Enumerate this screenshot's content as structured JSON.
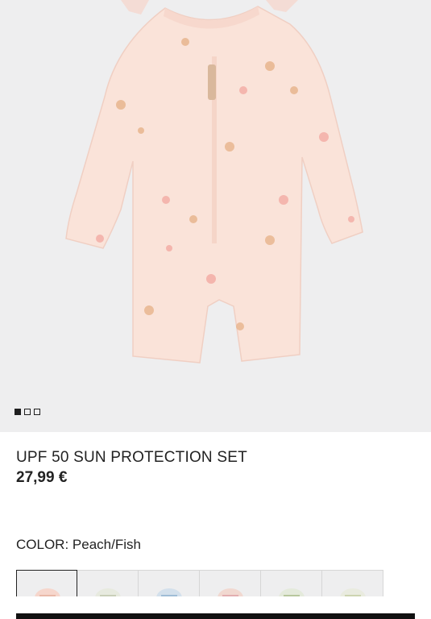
{
  "product": {
    "title": "UPF 50 SUN PROTECTION SET",
    "price": "27,99 €",
    "color_label": "COLOR:",
    "color_value": "Peach/Fish"
  },
  "gallery": {
    "image_count": 3,
    "active_index": 0,
    "main_image": "peach swimsuit with sea print",
    "colors": {
      "background": "#eeeeef",
      "garment": "#f9dfd6"
    }
  },
  "swatches": [
    {
      "name": "Peach/Fish",
      "selected": true,
      "tint": "#f6d6cc"
    },
    {
      "name": "swatch-2",
      "selected": false,
      "tint": "#e7eadf"
    },
    {
      "name": "swatch-3",
      "selected": false,
      "tint": "#d3e0ec"
    },
    {
      "name": "swatch-4",
      "selected": false,
      "tint": "#f1d8d0"
    },
    {
      "name": "swatch-5",
      "selected": false,
      "tint": "#e4eadb"
    },
    {
      "name": "swatch-6",
      "selected": false,
      "tint": "#e9ebdf"
    }
  ]
}
